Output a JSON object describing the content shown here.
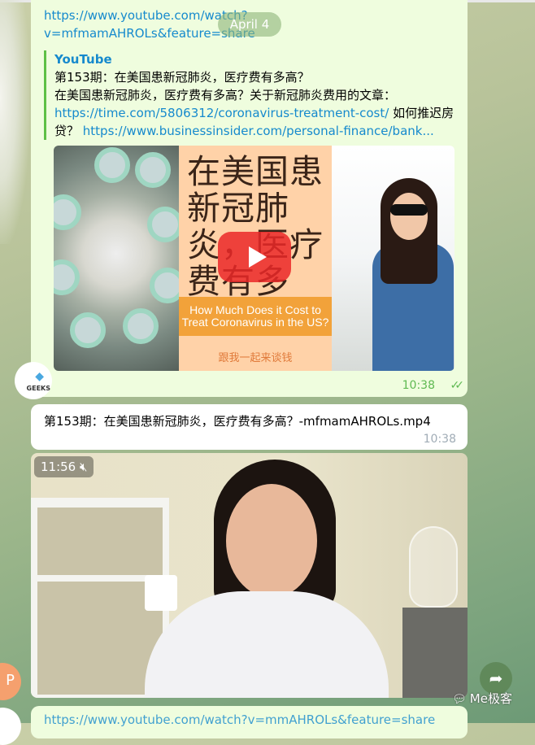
{
  "date_pill": "April 4",
  "message1": {
    "url_line1": "https://www.youtube.com/watch?",
    "url_line2": "v=mfmamAHROLs&feature=share",
    "preview": {
      "site": "YouTube",
      "title": "第153期：在美国患新冠肺炎，医疗费有多高？",
      "desc_text1": "在美国患新冠肺炎，医疗费有多高？关于新冠肺炎费用的文章：",
      "desc_link1": "https://time.com/5806312/coronavirus-treatment-cost/",
      "desc_text2": " 如何推迟房贷？ ",
      "desc_link2": "https://www.businessinsider.com/personal-finance/bank...",
      "thumb_title": "在美国患新冠肺炎，医疗费有多高？",
      "thumb_banner": "How Much Does it Cost to Treat Coronavirus in the US?",
      "thumb_footer": "跟我一起来谈钱"
    },
    "time": "10:38",
    "status": "read-double-check"
  },
  "avatar1_label": "GEEKS",
  "message2": {
    "filename": "第153期：在美国患新冠肺炎，医疗费有多高？-mfmamAHROLs.mp4",
    "time": "10:38"
  },
  "video": {
    "duration": "11:56",
    "muted": true
  },
  "avatar2_initial": "P",
  "message3": {
    "url_partial": "https://www.youtube.com/watch?v=mmAHROLs&feature=share"
  },
  "watermark": "Me极客",
  "colors": {
    "outgoing_bubble": "#effdde",
    "link": "#168acd",
    "accent_green": "#5fb952"
  }
}
